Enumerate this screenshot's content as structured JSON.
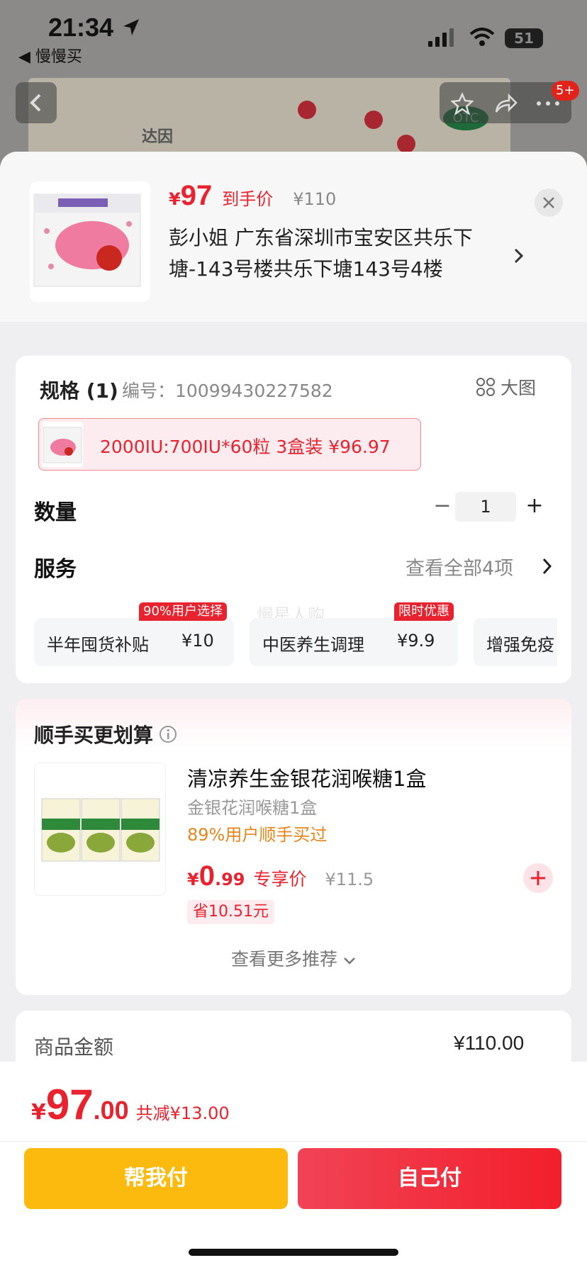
{
  "status_bar": {
    "time": "21:34",
    "back_app": "◀ 慢慢买",
    "battery": "51"
  },
  "nav": {
    "cart_badge": "5+"
  },
  "background": {
    "brand": "达因",
    "otc": "OTC"
  },
  "header": {
    "price_symbol": "¥",
    "price": "97",
    "price_label": "到手价",
    "original_price": "¥110",
    "address": "彭小姐  广东省深圳市宝安区共乐下塘-143号楼共乐下塘143号4楼"
  },
  "spec": {
    "title": "规格 (1)",
    "code": "编号：10099430227582",
    "big_pic": "大图",
    "option": "2000IU:700IU*60粒 3盒装  ¥96.97"
  },
  "quantity": {
    "label": "数量",
    "value": "1",
    "minus": "−",
    "plus": "+"
  },
  "services": {
    "label": "服务",
    "view_all": "查看全部4项",
    "watermark": "慢星人购",
    "items": [
      {
        "name": "半年囤货补贴",
        "price": "¥10",
        "tag": "90%用户选择"
      },
      {
        "name": "中医养生调理",
        "price": "¥9.9",
        "tag": "限时优惠"
      },
      {
        "name": "增强免疫",
        "price": ""
      }
    ]
  },
  "bundle": {
    "title": "顺手买更划算",
    "product_name": "清凉养生金银花润喉糖1盒",
    "product_sub": "金银花润喉糖1盒",
    "buy_rate": "89%用户顺手买过",
    "price_symbol": "¥",
    "price_int": "0",
    "price_dec": ".99",
    "price_label": "专享价",
    "original_price": "¥11.5",
    "save": "省10.51元",
    "more": "查看更多推荐"
  },
  "summary": {
    "label": "商品金额",
    "value": "¥110.00"
  },
  "footer": {
    "symbol": "¥",
    "total_int": "97",
    "total_dec": ".00",
    "reduction": "共减¥13.00",
    "help_pay": "帮我付",
    "self_pay": "自己付"
  },
  "colors": {
    "accent_red": "#e8232f",
    "help_yellow": "#fdba0e",
    "orange": "#e6851b"
  }
}
